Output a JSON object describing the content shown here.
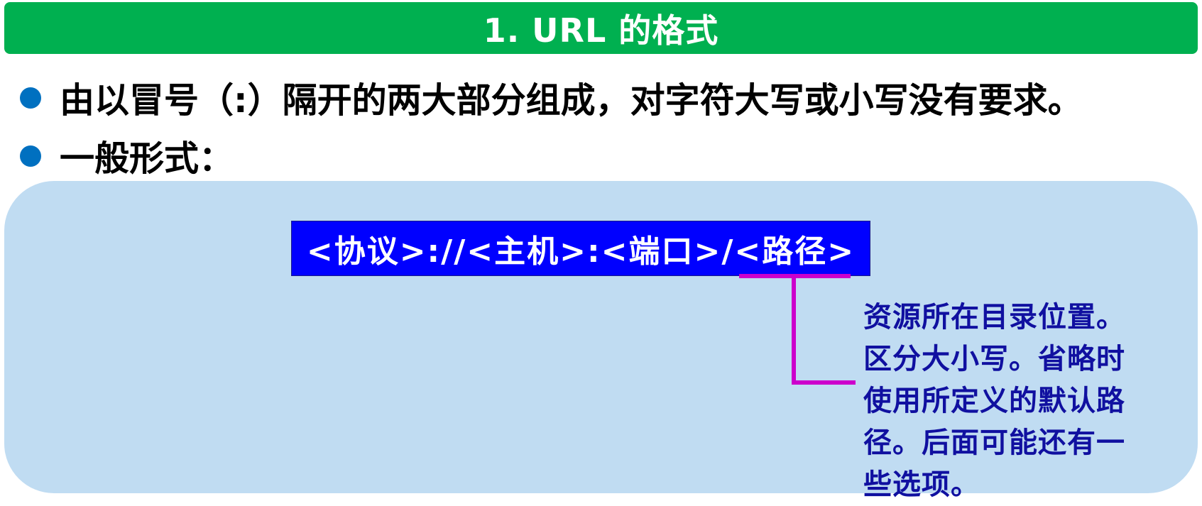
{
  "header": {
    "title": "1. URL 的格式"
  },
  "bullets": [
    {
      "text": "由以冒号（:）隔开的两大部分组成，对字符大写或小写没有要求。"
    },
    {
      "text": "一般形式："
    }
  ],
  "diagram": {
    "format": "<协议>://<主机>:<端口>/<路径>",
    "path_annotation": "资源所在目录位置。区分大小写。省略时使用所定义的默认路径。后面可能还有一些选项。",
    "colors": {
      "title_bg": "#00b050",
      "bullet": "#0070c0",
      "panel_bg": "#c0dcf2",
      "format_box_bg": "#0000ff",
      "connector": "#cc00cc",
      "annotation_text": "#1010a0"
    }
  }
}
